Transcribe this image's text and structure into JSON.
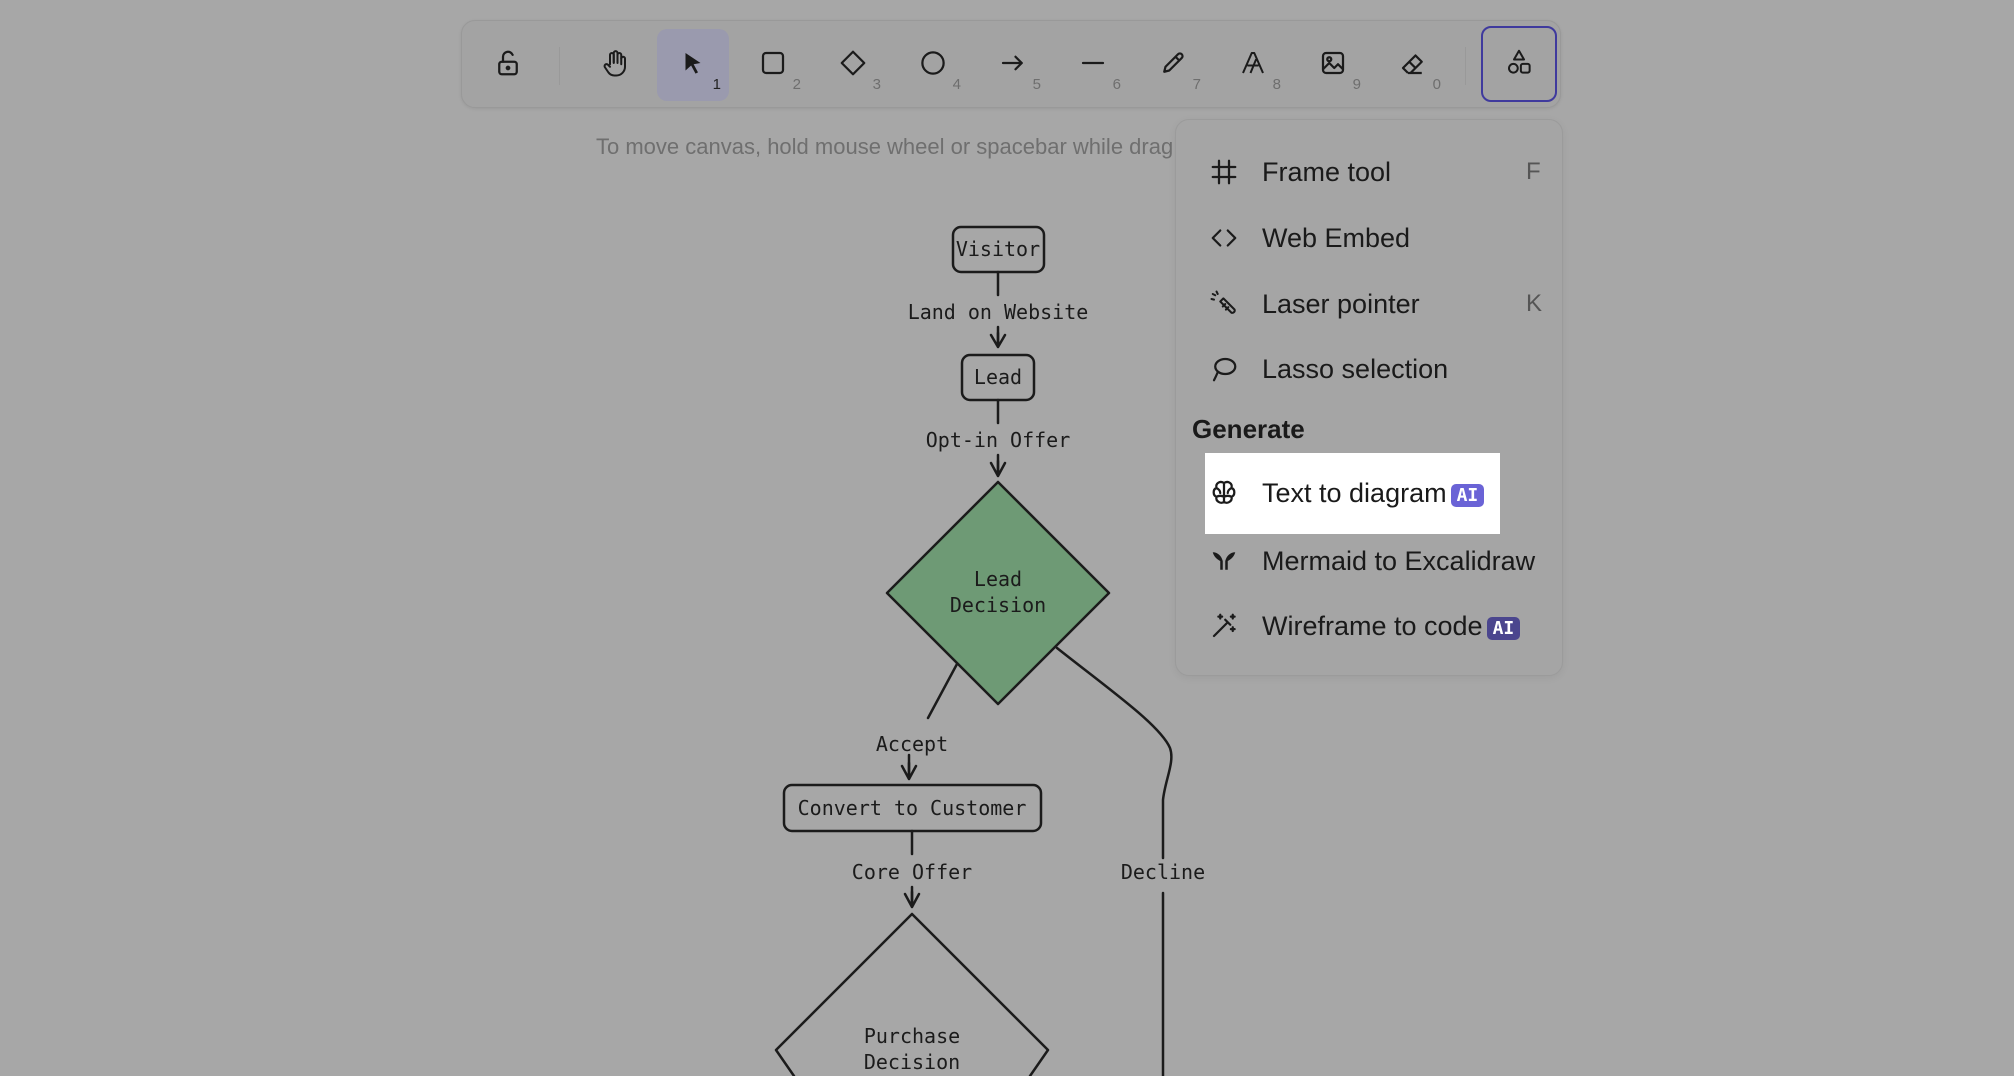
{
  "toolbar": {
    "tools": [
      {
        "name": "lock-tool",
        "icon": "lock-open-icon",
        "key": ""
      },
      {
        "name": "hand-tool",
        "icon": "hand-icon",
        "key": ""
      },
      {
        "name": "selection-tool",
        "icon": "pointer-icon",
        "key": "1",
        "active": true
      },
      {
        "name": "rectangle-tool",
        "icon": "rectangle-icon",
        "key": "2"
      },
      {
        "name": "diamond-tool",
        "icon": "diamond-icon",
        "key": "3"
      },
      {
        "name": "ellipse-tool",
        "icon": "circle-icon",
        "key": "4"
      },
      {
        "name": "arrow-tool",
        "icon": "arrow-right-icon",
        "key": "5"
      },
      {
        "name": "line-tool",
        "icon": "line-icon",
        "key": "6"
      },
      {
        "name": "draw-tool",
        "icon": "pencil-icon",
        "key": "7"
      },
      {
        "name": "text-tool",
        "icon": "text-icon",
        "key": "8"
      },
      {
        "name": "image-tool",
        "icon": "image-icon",
        "key": "9"
      },
      {
        "name": "eraser-tool",
        "icon": "eraser-icon",
        "key": "0"
      },
      {
        "name": "more-tools",
        "icon": "shapes-icon",
        "key": ""
      }
    ]
  },
  "hint": "To move canvas, hold mouse wheel or spacebar while drag",
  "menu": {
    "frame_tool": {
      "label": "Frame tool",
      "shortcut": "F"
    },
    "web_embed": {
      "label": "Web Embed"
    },
    "laser_pointer": {
      "label": "Laser pointer",
      "shortcut": "K"
    },
    "lasso": {
      "label": "Lasso selection"
    },
    "generate_heading": "Generate",
    "text_to_diagram": {
      "label": "Text to diagram",
      "badge": "AI"
    },
    "mermaid": {
      "label": "Mermaid to Excalidraw"
    },
    "wireframe": {
      "label": "Wireframe to code",
      "badge": "AI"
    }
  },
  "diagram": {
    "visitor": "Visitor",
    "land_on_website": "Land on Website",
    "lead": "Lead",
    "opt_in_offer": "Opt-in Offer",
    "lead_decision_1": "Lead",
    "lead_decision_2": "Decision",
    "accept": "Accept",
    "convert_to_customer": "Convert to Customer",
    "core_offer": "Core Offer",
    "decline": "Decline",
    "purchase_decision_1": "Purchase",
    "purchase_decision_2": "Decision"
  },
  "colors": {
    "canvas_bg": "#a7a7a7",
    "accent": "#3f3a9d",
    "diamond_fill": "#6e9a75",
    "badge_bright": "#6a63d6",
    "badge_dim": "#4b468e"
  }
}
